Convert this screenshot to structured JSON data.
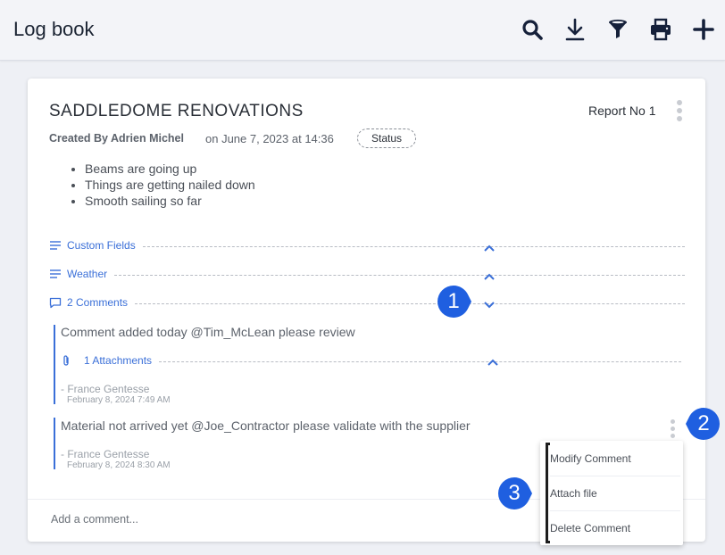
{
  "header": {
    "title": "Log book",
    "actions": [
      {
        "icon": "search-icon"
      },
      {
        "icon": "download-icon"
      },
      {
        "icon": "filter-icon"
      },
      {
        "icon": "print-icon"
      },
      {
        "icon": "plus-icon"
      }
    ]
  },
  "entry": {
    "title": "SADDLEDOME RENOVATIONS",
    "report_no": "Report No 1",
    "created_by": "Created By Adrien Michel",
    "created_on": "on June 7, 2023 at 14:36",
    "status": "Status",
    "notes": [
      "Beams are going up",
      "Things are getting nailed down",
      "Smooth sailing so far"
    ],
    "sections": {
      "custom_fields": "Custom Fields",
      "weather": "Weather",
      "comments": "2 Comments"
    },
    "comments": [
      {
        "text": "Comment added today @Tim_McLean please review",
        "attachments_label": "1 Attachments",
        "author": "- France Gentesse",
        "date": "February 8, 2024 7:49 AM"
      },
      {
        "text": "Material not arrived yet @Joe_Contractor please validate with the supplier",
        "author": "- France Gentesse",
        "date": "February 8, 2024 8:30 AM"
      }
    ],
    "add_comment_placeholder": "Add a comment..."
  },
  "context_menu": {
    "items": [
      "Modify Comment",
      "Attach file",
      "Delete Comment"
    ]
  },
  "callouts": [
    "1",
    "2",
    "3"
  ],
  "colors": {
    "accent": "#3a6fd8",
    "callout": "#1f5fe0",
    "title": "#1b2433"
  }
}
